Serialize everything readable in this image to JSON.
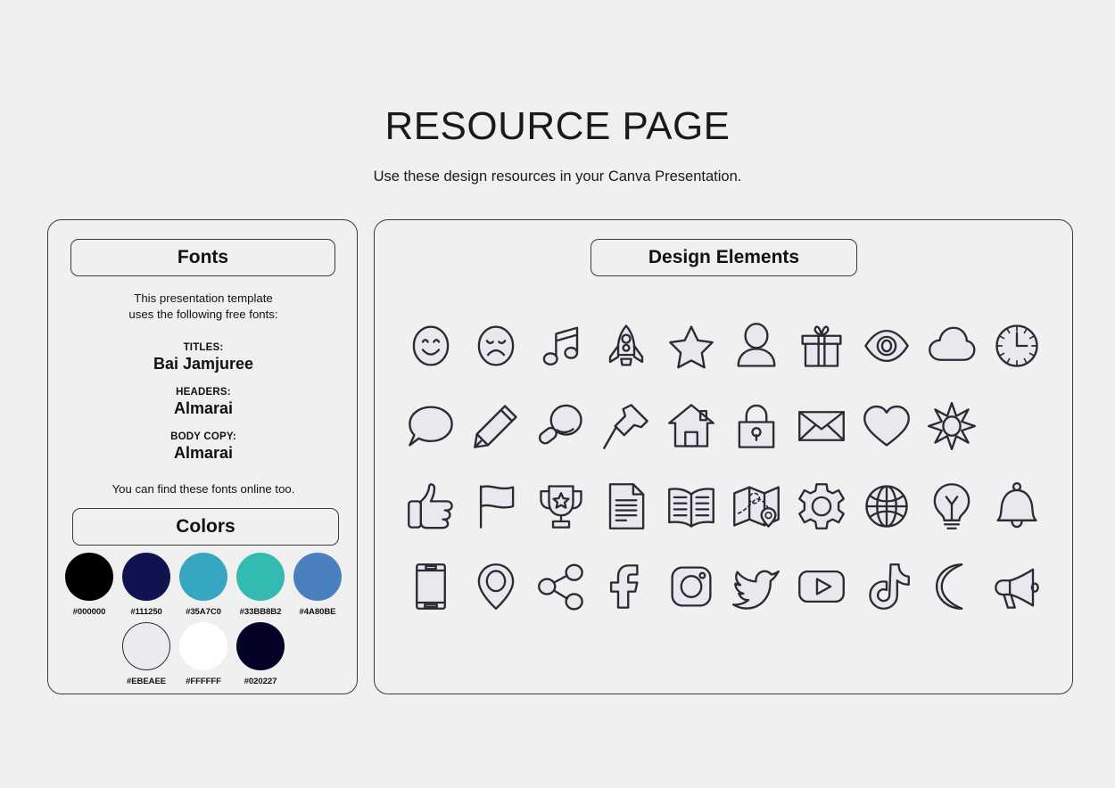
{
  "header": {
    "title": "RESOURCE PAGE",
    "subtitle": "Use these design resources in your Canva Presentation."
  },
  "fonts_panel": {
    "section_label": "Fonts",
    "intro_line_1": "This presentation template",
    "intro_line_2": "uses the following free fonts:",
    "entries": [
      {
        "label": "TITLES:",
        "name": "Bai Jamjuree"
      },
      {
        "label": "HEADERS:",
        "name": "Almarai"
      },
      {
        "label": "BODY COPY:",
        "name": "Almarai"
      }
    ],
    "outro": "You can find these fonts online too."
  },
  "colors_panel": {
    "section_label": "Colors",
    "row_1": [
      {
        "hex": "#000000",
        "label": "#000000",
        "outlined": false
      },
      {
        "hex": "#111250",
        "label": "#111250",
        "outlined": false
      },
      {
        "hex": "#35A7C0",
        "label": "#35A7C0",
        "outlined": false
      },
      {
        "hex": "#33BB8B2",
        "label": "#33BB8B2",
        "outlined": false,
        "swatch": "#33BBB2"
      },
      {
        "hex": "#4A80BE",
        "label": "#4A80BE",
        "outlined": false
      }
    ],
    "row_2": [
      {
        "hex": "#EBEAEE",
        "label": "#EBEAEE",
        "outlined": true
      },
      {
        "hex": "#FFFFFF",
        "label": "#FFFFFF",
        "outlined": false
      },
      {
        "hex": "#020227",
        "label": "#020227",
        "outlined": false
      }
    ]
  },
  "elements_panel": {
    "section_label": "Design Elements",
    "icons": [
      "smiley-face-icon",
      "sad-face-icon",
      "music-note-icon",
      "rocket-icon",
      "star-icon",
      "user-icon",
      "gift-icon",
      "eye-icon",
      "cloud-icon",
      "clock-icon",
      "speech-bubble-icon",
      "pencil-icon",
      "magnifier-icon",
      "pushpin-icon",
      "house-icon",
      "lock-icon",
      "envelope-icon",
      "heart-icon",
      "sun-icon",
      "thumbs-up-icon",
      "flag-icon",
      "trophy-icon",
      "document-icon",
      "open-book-icon",
      "map-icon",
      "gear-icon",
      "globe-icon",
      "lightbulb-icon",
      "bell-icon",
      "smartphone-icon",
      "location-pin-icon",
      "share-icon",
      "facebook-icon",
      "instagram-icon",
      "twitter-icon",
      "youtube-icon",
      "tiktok-icon",
      "moon-icon",
      "megaphone-icon"
    ]
  }
}
